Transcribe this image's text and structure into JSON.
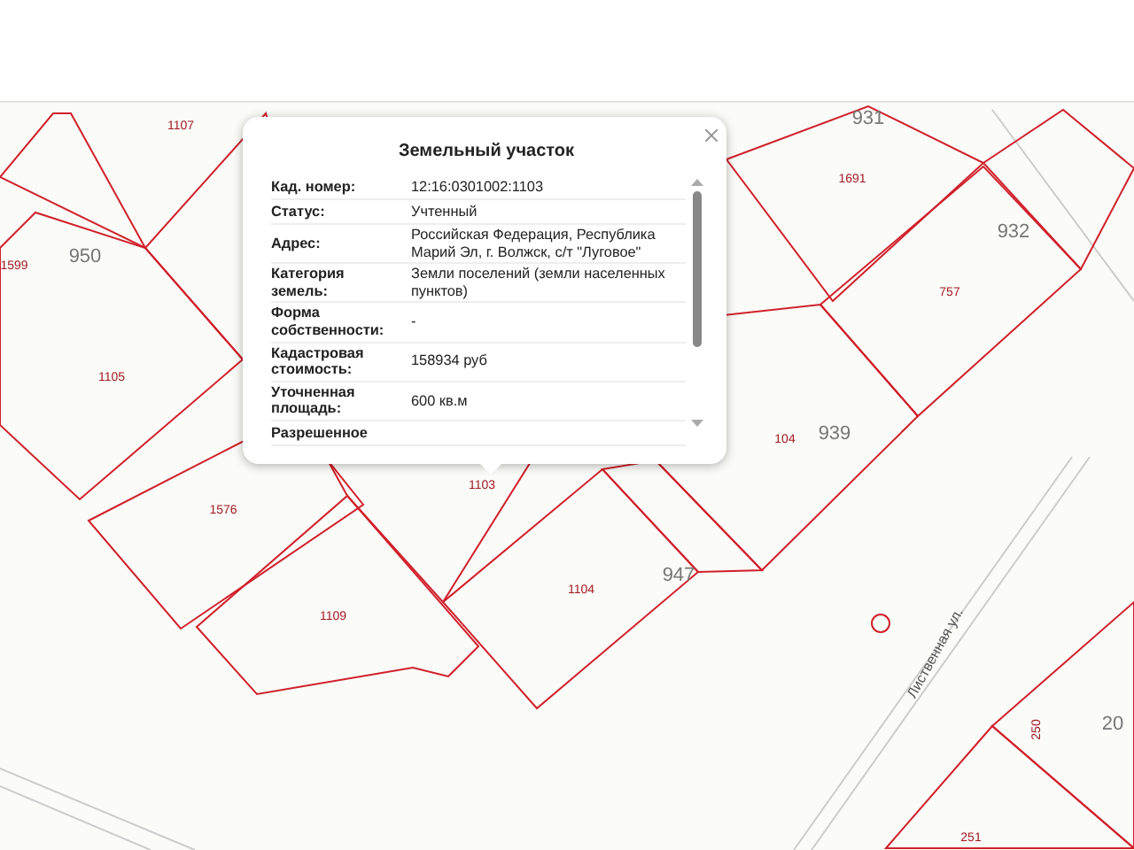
{
  "map_labels": [
    {
      "text": "1107",
      "kind": "parcel"
    },
    {
      "text": "1599",
      "kind": "parcel"
    },
    {
      "text": "950",
      "kind": "block"
    },
    {
      "text": "1105",
      "kind": "parcel"
    },
    {
      "text": "1576",
      "kind": "parcel"
    },
    {
      "text": "1109",
      "kind": "parcel"
    },
    {
      "text": "1103",
      "kind": "parcel"
    },
    {
      "text": "1104",
      "kind": "parcel"
    },
    {
      "text": "947",
      "kind": "block"
    },
    {
      "text": "931",
      "kind": "block"
    },
    {
      "text": "1691",
      "kind": "parcel"
    },
    {
      "text": "932",
      "kind": "block"
    },
    {
      "text": "757",
      "kind": "parcel"
    },
    {
      "text": "104",
      "kind": "parcel"
    },
    {
      "text": "939",
      "kind": "block"
    },
    {
      "text": "250",
      "kind": "parcel"
    },
    {
      "text": "20",
      "kind": "block"
    },
    {
      "text": "251",
      "kind": "parcel"
    },
    {
      "text": "Лиственная ул.",
      "kind": "street"
    }
  ],
  "popup": {
    "title": "Земельный участок",
    "rows": [
      {
        "label": "Кад. номер:",
        "value": "12:16:0301002:1103"
      },
      {
        "label": "Статус:",
        "value": "Учтенный"
      },
      {
        "label": "Адрес:",
        "value": "Российская Федерация, Республика Марий Эл, г. Волжск, с/т \"Луговое\""
      },
      {
        "label": "Категория земель:",
        "value": "Земли поселений (земли населенных пунктов)"
      },
      {
        "label": "Форма собственности:",
        "value": "-"
      },
      {
        "label": "Кадастровая стоимость:",
        "value": "158934 руб"
      },
      {
        "label": "Уточненная площадь:",
        "value": "600 кв.м"
      },
      {
        "label": "Разрешенное"
      }
    ]
  }
}
